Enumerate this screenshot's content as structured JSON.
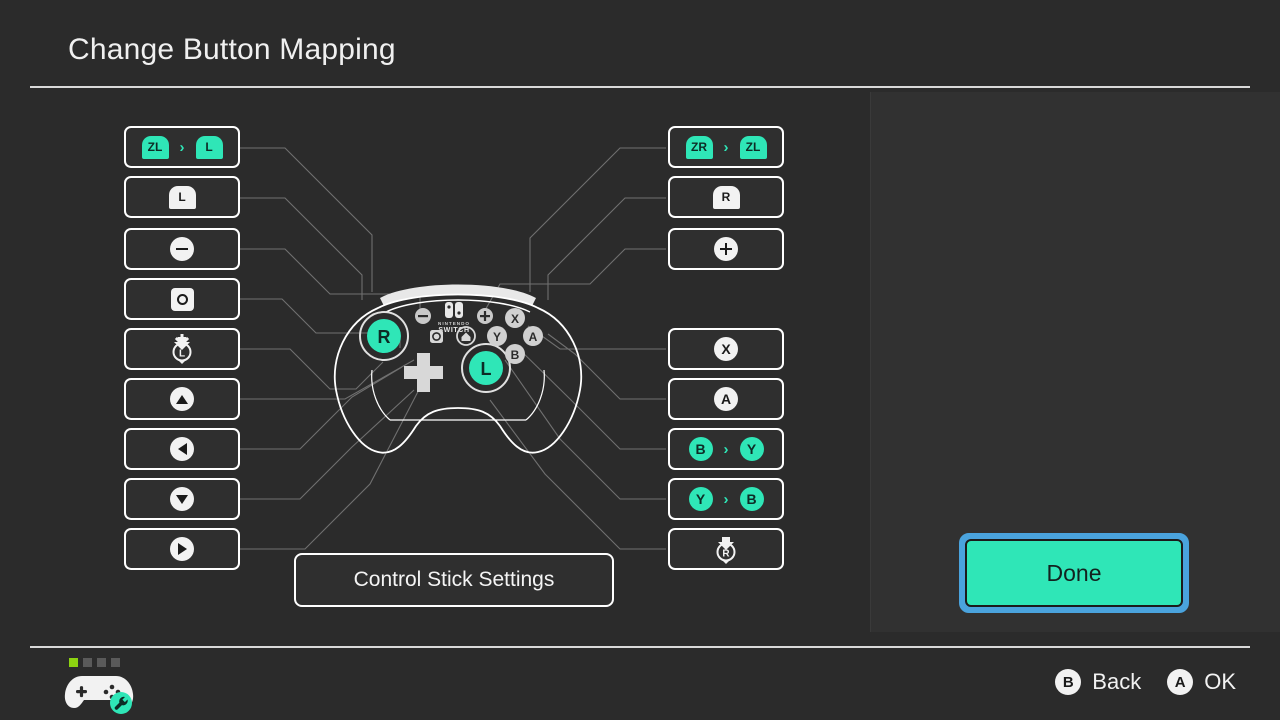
{
  "header": {
    "title": "Change Button Mapping"
  },
  "accent": {
    "teal": "#2fe6b7",
    "selection_blue": "#4aa3dd",
    "led_green": "#8cd211",
    "white": "#ffffff",
    "background": "#2b2b2b"
  },
  "left_column": [
    {
      "name": "zl-mapped-to-l",
      "type": "mapping",
      "from": {
        "label": "ZL",
        "style": "shoulder",
        "color": "teal"
      },
      "to": {
        "label": "L",
        "style": "shoulder",
        "color": "teal"
      },
      "separator": "›",
      "remapped": true
    },
    {
      "name": "l-button",
      "type": "single",
      "glyph": {
        "label": "L",
        "style": "shoulder",
        "color": "white"
      },
      "remapped": false
    },
    {
      "name": "minus-button",
      "type": "single",
      "glyph": {
        "label": "−",
        "style": "minus",
        "color": "white"
      },
      "remapped": false
    },
    {
      "name": "capture-button",
      "type": "single",
      "glyph": {
        "label": "Capture",
        "style": "capture",
        "color": "white"
      },
      "remapped": false
    },
    {
      "name": "left-stick-press",
      "type": "single",
      "glyph": {
        "label": "L",
        "style": "stick-press",
        "color": "white"
      },
      "remapped": false
    },
    {
      "name": "dpad-up",
      "type": "single",
      "glyph": {
        "label": "Up",
        "style": "dpad-up",
        "color": "white"
      },
      "remapped": false
    },
    {
      "name": "dpad-left",
      "type": "single",
      "glyph": {
        "label": "Left",
        "style": "dpad-left",
        "color": "white"
      },
      "remapped": false
    },
    {
      "name": "dpad-down",
      "type": "single",
      "glyph": {
        "label": "Down",
        "style": "dpad-down",
        "color": "white"
      },
      "remapped": false
    },
    {
      "name": "dpad-right",
      "type": "single",
      "glyph": {
        "label": "Right",
        "style": "dpad-right",
        "color": "white"
      },
      "remapped": false
    }
  ],
  "right_column": [
    {
      "name": "zr-mapped-to-zl",
      "type": "mapping",
      "from": {
        "label": "ZR",
        "style": "shoulder",
        "color": "teal"
      },
      "to": {
        "label": "ZL",
        "style": "shoulder",
        "color": "teal"
      },
      "separator": "›",
      "remapped": true
    },
    {
      "name": "r-button",
      "type": "single",
      "glyph": {
        "label": "R",
        "style": "shoulder",
        "color": "white"
      },
      "remapped": false
    },
    {
      "name": "plus-button",
      "type": "single",
      "glyph": {
        "label": "+",
        "style": "plus",
        "color": "white"
      },
      "remapped": false
    },
    {
      "name": "x-button",
      "type": "single",
      "glyph": {
        "label": "X",
        "style": "round",
        "color": "white"
      },
      "remapped": false
    },
    {
      "name": "a-button",
      "type": "single",
      "glyph": {
        "label": "A",
        "style": "round",
        "color": "white"
      },
      "remapped": false
    },
    {
      "name": "b-mapped-to-y",
      "type": "mapping",
      "from": {
        "label": "B",
        "style": "round",
        "color": "teal"
      },
      "to": {
        "label": "Y",
        "style": "round",
        "color": "teal"
      },
      "separator": "›",
      "remapped": true
    },
    {
      "name": "y-mapped-to-b",
      "type": "mapping",
      "from": {
        "label": "Y",
        "style": "round",
        "color": "teal"
      },
      "to": {
        "label": "B",
        "style": "round",
        "color": "teal"
      },
      "separator": "›",
      "remapped": true
    },
    {
      "name": "right-stick-press",
      "type": "single",
      "glyph": {
        "label": "R",
        "style": "stick-press",
        "color": "white"
      },
      "remapped": false
    }
  ],
  "controller": {
    "brand": "NINTENDO SWITCH",
    "left_stick_label": "R",
    "right_stick_label": "L",
    "face_buttons": [
      "X",
      "Y",
      "A",
      "B"
    ],
    "minus_label": "−",
    "plus_label": "+",
    "home_label": "Home",
    "capture_label": "Capture"
  },
  "stick_settings": {
    "label": "Control Stick Settings"
  },
  "done": {
    "label": "Done",
    "selected": true
  },
  "footer": {
    "player_leds": [
      true,
      false,
      false,
      false
    ],
    "controller_badge": "wrench",
    "hints": [
      {
        "key": "B",
        "label": "Back"
      },
      {
        "key": "A",
        "label": "OK"
      }
    ]
  }
}
